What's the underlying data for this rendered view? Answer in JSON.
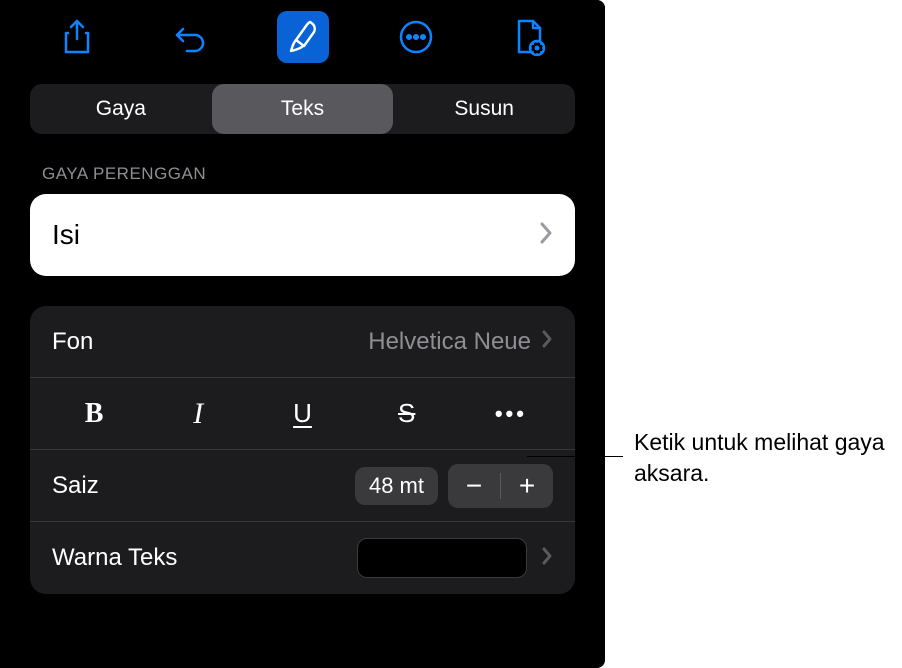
{
  "toolbar": {
    "share": "share-icon",
    "undo": "undo-icon",
    "format": "format-brush-icon",
    "more": "more-icon",
    "document": "document-icon"
  },
  "tabs": {
    "style": "Gaya",
    "text": "Teks",
    "arrange": "Susun",
    "selected": "text"
  },
  "paragraphStyle": {
    "sectionLabel": "GAYA PERENGGAN",
    "value": "Isi"
  },
  "font": {
    "label": "Fon",
    "value": "Helvetica Neue"
  },
  "styleButtons": {
    "bold": "B",
    "italic": "I",
    "underline": "U",
    "strike": "S",
    "more": "•••"
  },
  "size": {
    "label": "Saiz",
    "value": "48 mt",
    "minus": "−",
    "plus": "+"
  },
  "textColor": {
    "label": "Warna Teks",
    "swatch": "#000000"
  },
  "callout": {
    "text": "Ketik untuk melihat gaya aksara."
  }
}
